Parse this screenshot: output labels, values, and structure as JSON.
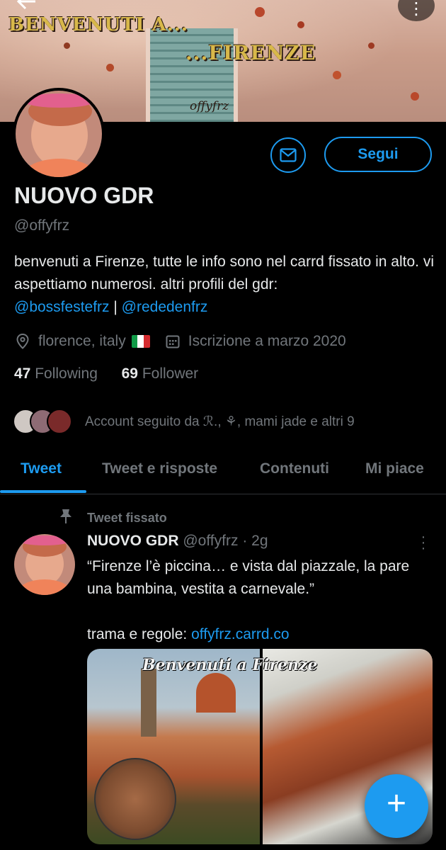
{
  "banner": {
    "line1": "BENVENUTI A...",
    "line2": "...FIRENZE",
    "signature": "offyfrz"
  },
  "profile": {
    "name": "NUOVO GDR",
    "handle": "@offyfrz",
    "follow_label": "Segui",
    "bio_text": "benvenuti a Firenze, tutte le info sono nel carrd fissato in alto. vi aspettiamo numerosi. altri profili del gdr:",
    "bio_link1": "@bossfestefrz",
    "bio_sep": " | ",
    "bio_link2": "@rededenfrz",
    "location": "florence, italy",
    "joined": "Iscrizione a marzo 2020",
    "following_count": "47",
    "following_label": "Following",
    "follower_count": "69",
    "follower_label": "Follower",
    "followed_by": "Account seguito da ℛ., ⚘, mami jade e altri 9"
  },
  "tabs": [
    {
      "label": "Tweet",
      "active": true
    },
    {
      "label": "Tweet e risposte",
      "active": false
    },
    {
      "label": "Contenuti",
      "active": false
    },
    {
      "label": "Mi piace",
      "active": false
    }
  ],
  "pinned_tweet": {
    "pinned_label": "Tweet fissato",
    "author_name": "NUOVO GDR",
    "author_handle": "@offyfrz",
    "time": "· 2g",
    "text": "“Firenze l’è piccina… e vista dal piazzale, la pare una bambina, vestita a carnevale.”\n\ntrama e regole: ",
    "link": "offyfrz.carrd.co",
    "media_caption": "Benvenuti a Firenze"
  },
  "icons": {
    "back": "back-arrow-icon",
    "more": "more-vertical-icon",
    "mail": "mail-icon",
    "location": "location-pin-icon",
    "calendar": "calendar-icon",
    "pin": "pin-icon",
    "compose": "plus-icon"
  },
  "colors": {
    "accent": "#1d9bf0",
    "background": "#000000",
    "text": "#e7e9ea",
    "secondary": "#71767b"
  }
}
